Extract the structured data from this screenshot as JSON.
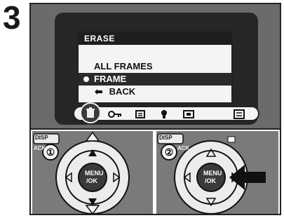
{
  "step_number": "3",
  "menu": {
    "title": "ERASE",
    "items": [
      "ALL FRAMES",
      "FRAME",
      "BACK"
    ],
    "selected": "FRAME"
  },
  "toolbar": {
    "icons": [
      "erase-icon",
      "protect-key-icon",
      "print-order-icon",
      "voice-memo-icon",
      "trim-icon",
      "setup-icon"
    ]
  },
  "panels": {
    "left": {
      "step": "①",
      "center_label_1": "MENU",
      "center_label_2": "/OK",
      "top_label": "DISP",
      "side_label": "ACK"
    },
    "right": {
      "step": "②",
      "center_label_1": "MENU",
      "center_label_2": "/OK",
      "top_label": "DISP",
      "side_label": "ACK"
    }
  }
}
